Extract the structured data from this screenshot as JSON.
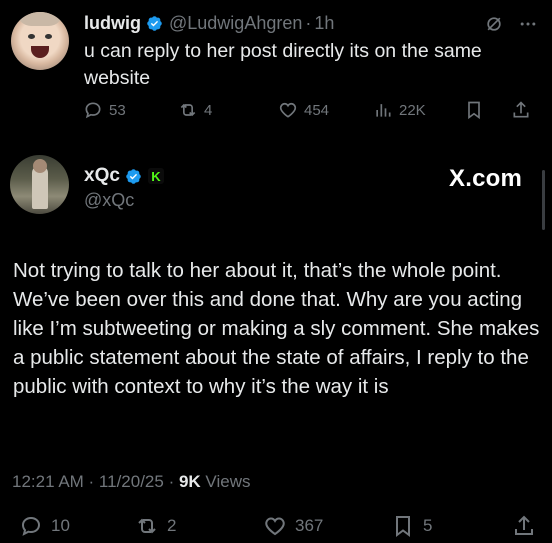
{
  "tweet1": {
    "author_name": "ludwig",
    "handle": "@LudwigAhgren",
    "separator": "·",
    "time": "1h",
    "text": "u can reply to her post directly its on the same website",
    "replies": "53",
    "reposts": "4",
    "likes": "454",
    "views": "22K"
  },
  "tweet2": {
    "author_name": "xQc",
    "handle": "@xQc",
    "badge_letter": "K",
    "watermark": "X.com",
    "text": "Not trying to talk to her about it, that’s the whole point. We’ve been over this and done that. Why are you acting like I’m subtweeting or making a sly comment. She makes a public statement about the state of affairs, I reply to the public with context to why it’s the way it is",
    "timestamp": "12:21 AM · 11/20/25 · ",
    "views_count": "9K",
    "views_label": " Views",
    "replies": "10",
    "reposts": "2",
    "likes": "367",
    "bookmarks": "5"
  },
  "colors": {
    "background": "#000000",
    "text": "#e7e9ea",
    "muted": "#71767b",
    "verified": "#1d9bf0",
    "kick_green": "#53fc18"
  },
  "icons": [
    "verified-badge-icon",
    "grok-icon",
    "more-icon",
    "reply-icon",
    "repost-icon",
    "like-icon",
    "views-icon",
    "bookmark-icon",
    "share-icon",
    "kick-badge-icon"
  ]
}
